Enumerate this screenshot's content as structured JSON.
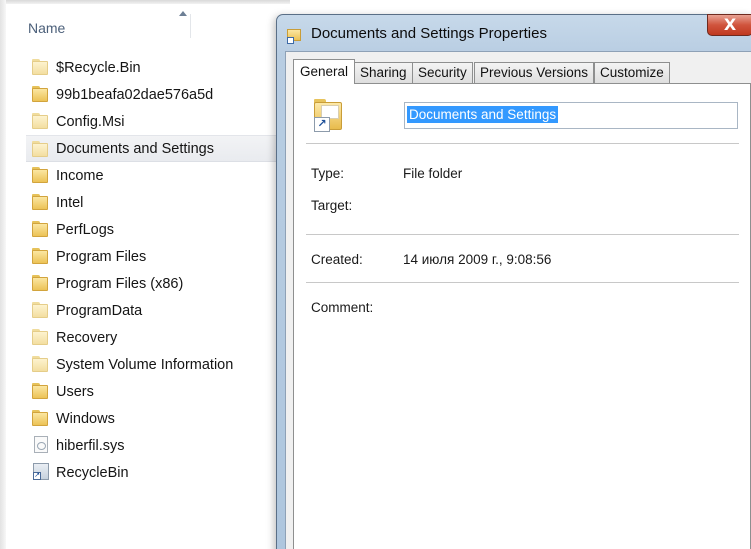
{
  "explorer": {
    "column_header": "Name",
    "items": [
      {
        "name": "$Recycle.Bin",
        "icon": "folder-pale-icon"
      },
      {
        "name": "99b1beafa02dae576a5d",
        "icon": "folder-icon"
      },
      {
        "name": "Config.Msi",
        "icon": "folder-pale-icon"
      },
      {
        "name": "Documents and Settings",
        "icon": "folder-shortcut-icon"
      },
      {
        "name": "Income",
        "icon": "folder-icon"
      },
      {
        "name": "Intel",
        "icon": "folder-icon"
      },
      {
        "name": "PerfLogs",
        "icon": "folder-icon"
      },
      {
        "name": "Program Files",
        "icon": "folder-icon"
      },
      {
        "name": "Program Files (x86)",
        "icon": "folder-icon"
      },
      {
        "name": "ProgramData",
        "icon": "folder-pale-icon"
      },
      {
        "name": "Recovery",
        "icon": "folder-pale-icon"
      },
      {
        "name": "System Volume Information",
        "icon": "folder-pale-icon"
      },
      {
        "name": "Users",
        "icon": "folder-icon"
      },
      {
        "name": "Windows",
        "icon": "folder-icon"
      },
      {
        "name": "hiberfil.sys",
        "icon": "system-file-icon"
      },
      {
        "name": "RecycleBin",
        "icon": "shortcut-icon"
      }
    ],
    "selected_item": "Documents and Settings"
  },
  "dialog": {
    "title": "Documents and Settings Properties",
    "close_glyph": "X",
    "tabs": [
      {
        "label": "General",
        "active": true
      },
      {
        "label": "Sharing",
        "active": false
      },
      {
        "label": "Security",
        "active": false
      },
      {
        "label": "Previous Versions",
        "active": false
      },
      {
        "label": "Customize",
        "active": false
      }
    ],
    "name_value": "Documents and Settings",
    "fields": {
      "type_label": "Type:",
      "type_value": "File folder",
      "target_label": "Target:",
      "target_value": "",
      "created_label": "Created:",
      "created_value": "14 июля 2009 г., 9:08:56",
      "comment_label": "Comment:",
      "comment_value": ""
    }
  },
  "colors": {
    "selection_blue": "#3399ff",
    "close_button_red": "#d0543d",
    "dialog_frame": "#b8cde2"
  }
}
